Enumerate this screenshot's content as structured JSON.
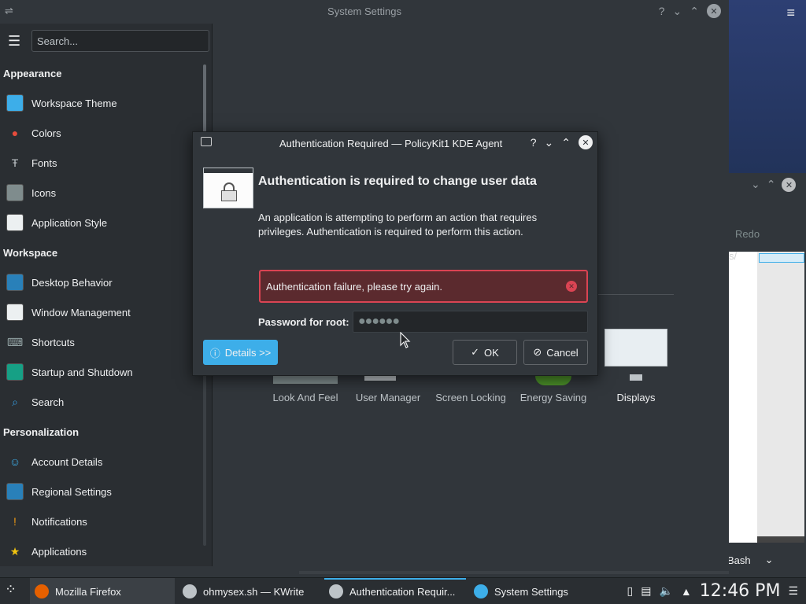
{
  "settings_window": {
    "title": "System Settings",
    "search_placeholder": "Search...",
    "groups": [
      {
        "label": "Appearance",
        "items": [
          {
            "label": "Workspace Theme",
            "icon": "workspace-theme-icon"
          },
          {
            "label": "Colors",
            "icon": "colors-icon"
          },
          {
            "label": "Fonts",
            "icon": "fonts-icon"
          },
          {
            "label": "Icons",
            "icon": "icons-icon"
          },
          {
            "label": "Application Style",
            "icon": "application-style-icon"
          }
        ]
      },
      {
        "label": "Workspace",
        "items": [
          {
            "label": "Desktop Behavior",
            "icon": "desktop-behavior-icon"
          },
          {
            "label": "Window Management",
            "icon": "window-management-icon"
          },
          {
            "label": "Shortcuts",
            "icon": "keyboard-icon"
          },
          {
            "label": "Startup and Shutdown",
            "icon": "startup-icon"
          },
          {
            "label": "Search",
            "icon": "search-icon"
          }
        ]
      },
      {
        "label": "Personalization",
        "items": [
          {
            "label": "Account Details",
            "icon": "account-icon"
          },
          {
            "label": "Regional Settings",
            "icon": "regional-icon"
          },
          {
            "label": "Notifications",
            "icon": "notifications-icon"
          },
          {
            "label": "Applications",
            "icon": "applications-star-icon"
          }
        ]
      }
    ],
    "categories": [
      "Look And Feel",
      "User Manager",
      "Screen Locking",
      "Energy Saving",
      "Displays"
    ]
  },
  "background_window": {
    "redo_label": "Redo",
    "slash_text": "s/",
    "status_mode": "Bash"
  },
  "dialog": {
    "title": "Authentication Required — PolicyKit1 KDE Agent",
    "heading": "Authentication is required to change user data",
    "description": "An application is attempting to perform an action that requires privileges. Authentication is required to perform this action.",
    "error_message": "Authentication failure, please try again.",
    "password_label": "Password for root:",
    "password_value": "●●●●●●",
    "details_button": "Details >>",
    "ok_button": "OK",
    "cancel_button": "Cancel"
  },
  "taskbar": {
    "tasks": [
      {
        "label": "Mozilla Firefox",
        "icon": "firefox-icon"
      },
      {
        "label": "ohmysex.sh  — KWrite",
        "icon": "kwrite-icon"
      },
      {
        "label": "Authentication Requir...",
        "icon": "lock-dialog-icon"
      },
      {
        "label": "System Settings",
        "icon": "settings-icon"
      }
    ],
    "clock": "12:46 PM"
  },
  "colors": {
    "accent": "#3daee9",
    "error": "#da4453",
    "window_bg": "#31363b"
  }
}
